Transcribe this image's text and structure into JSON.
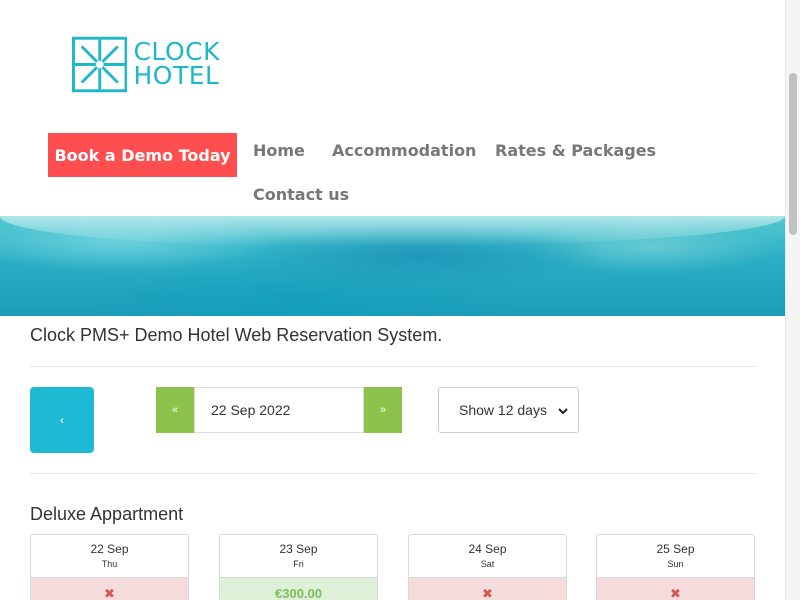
{
  "brand": {
    "line1": "CLOCK",
    "line2": "HOTEL",
    "accent": "#1eb8c9"
  },
  "header": {
    "cta_label": "Book a Demo Today",
    "cta_color": "#ff4e50",
    "nav": [
      "Home",
      "Accommodation",
      "Rates & Packages",
      "Contact us"
    ]
  },
  "main": {
    "title": "Clock PMS+ Demo Hotel Web Reservation System.",
    "controls": {
      "prev_icon": "‹",
      "prev_date_icon": "«",
      "next_date_icon": "»",
      "date_value": "22 Sep 2022",
      "days_selected": "Show 12 days"
    },
    "room": {
      "name": "Deluxe Appartment",
      "days": [
        {
          "date": "22 Sep",
          "dow": "Thu",
          "status": "✖",
          "available": false
        },
        {
          "date": "23 Sep",
          "dow": "Fri",
          "status": "€300.00",
          "available": true
        },
        {
          "date": "24 Sep",
          "dow": "Sat",
          "status": "✖",
          "available": false
        },
        {
          "date": "25 Sep",
          "dow": "Sun",
          "status": "✖",
          "available": false
        }
      ]
    }
  }
}
